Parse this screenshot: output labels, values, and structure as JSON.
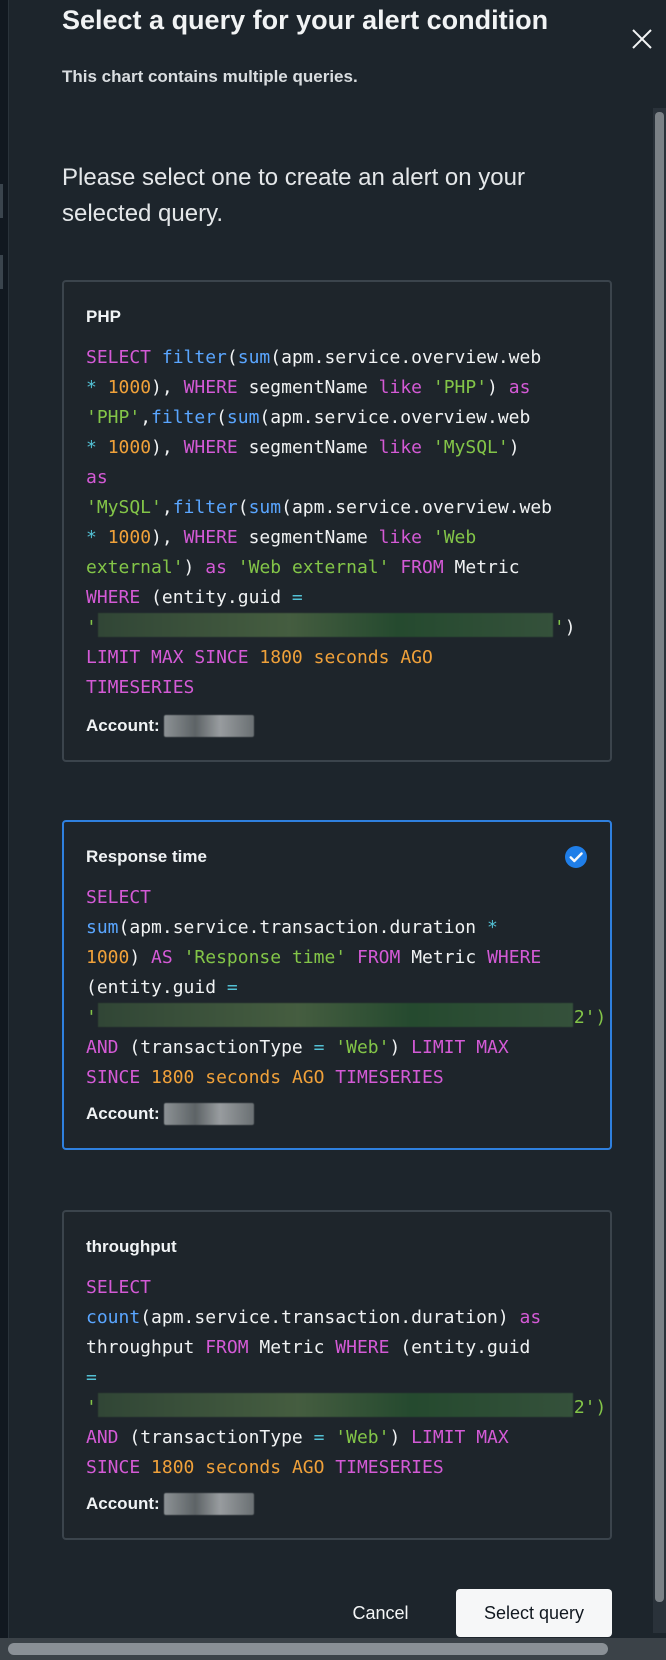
{
  "modal": {
    "title": "Select a query for your alert condition",
    "subtitle": "This chart contains multiple queries.",
    "instruction": "Please select one to create an alert on your selected query.",
    "close_icon": "close-icon"
  },
  "queries": [
    {
      "title": "PHP",
      "selected": false,
      "account_label": "Account:",
      "account_value_masked": true,
      "query": {
        "select": "SELECT",
        "filter": "filter",
        "sum": "sum",
        "metric_web": "apm.service.overview.web",
        "multiply": "*",
        "thousand": "1000",
        "where": "WHERE",
        "segment_name": "segmentName",
        "like": "like",
        "php_string": "'PHP'",
        "as": "as",
        "mysql_string": "'MySQL'",
        "web_string_start": "'Web",
        "web_string_end": "external'",
        "web_external_string": "'Web external'",
        "from": "FROM",
        "metric": "Metric",
        "entity_guid": "(entity.guid",
        "equals": "=",
        "quote": "'",
        "close_paren": ")",
        "limit": "LIMIT",
        "max": "MAX",
        "since": "SINCE",
        "duration": "1800",
        "seconds": "seconds",
        "ago": "AGO",
        "timeseries": "TIMESERIES"
      }
    },
    {
      "title": "Response time",
      "selected": true,
      "account_label": "Account:",
      "account_value_masked": true,
      "query": {
        "select": "SELECT",
        "sum": "sum",
        "metric_duration": "apm.service.transaction.duration",
        "multiply": "*",
        "thousand": "1000",
        "as": "AS",
        "response_time_string": "'Response time'",
        "from": "FROM",
        "metric": "Metric",
        "where": "WHERE",
        "entity_guid": "(entity.guid",
        "equals": "=",
        "quote": "'",
        "guid_suffix": "2')",
        "and": "AND",
        "transaction_type": "(transactionType",
        "web_string": "'Web'",
        "limit": "LIMIT",
        "max": "MAX",
        "since": "SINCE",
        "duration": "1800",
        "seconds": "seconds",
        "ago": "AGO",
        "timeseries": "TIMESERIES"
      }
    },
    {
      "title": "throughput",
      "selected": false,
      "account_label": "Account:",
      "account_value_masked": true,
      "query": {
        "select": "SELECT",
        "count": "count",
        "metric_duration": "apm.service.transaction.duration",
        "as": "as",
        "alias": "throughput",
        "from": "FROM",
        "metric": "Metric",
        "where": "WHERE",
        "entity_guid": "(entity.guid",
        "equals": "=",
        "quote": "'",
        "guid_suffix": "2')",
        "and": "AND",
        "transaction_type": "(transactionType",
        "web_string": "'Web'",
        "limit": "LIMIT",
        "max": "MAX",
        "since": "SINCE",
        "duration": "1800",
        "seconds": "seconds",
        "ago": "AGO",
        "timeseries": "TIMESERIES"
      }
    }
  ],
  "actions": {
    "cancel_label": "Cancel",
    "select_label": "Select query"
  },
  "icons": {
    "selected_check": "check-circle-icon"
  },
  "colors": {
    "background": "#1d252c",
    "card_border": "#3b444c",
    "selected_border": "#2f80df",
    "keyword": "#d45ad6",
    "function": "#5aa6ff",
    "string": "#83c548",
    "number": "#f0a13a",
    "operator": "#53c1d5"
  }
}
